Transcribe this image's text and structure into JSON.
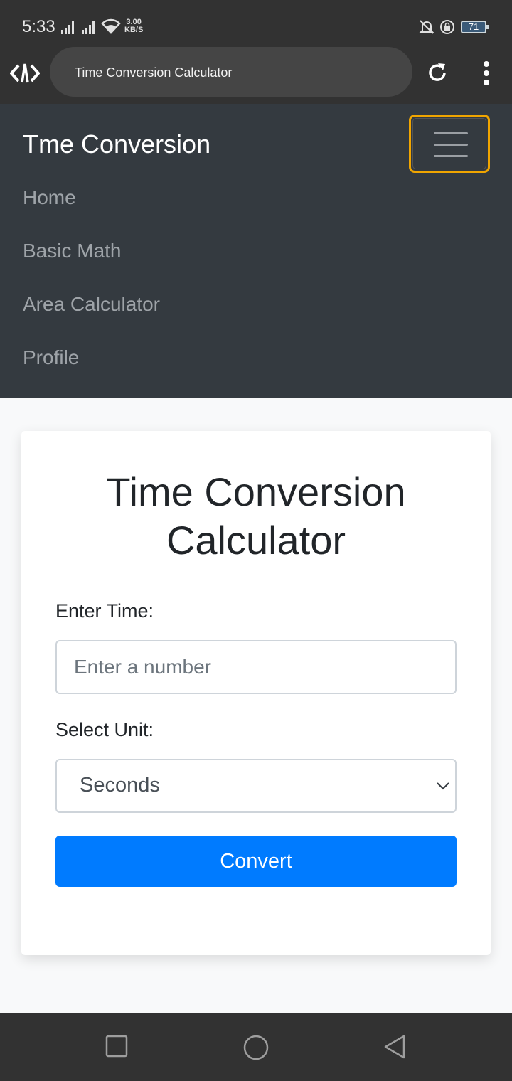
{
  "status_bar": {
    "time": "5:33",
    "speed_value": "3.00",
    "speed_unit": "KB/S",
    "battery": "71",
    "icons": [
      "signal-icon",
      "signal-icon",
      "wifi-icon",
      "mute-bell-icon",
      "lock-rotation-icon",
      "battery-icon"
    ]
  },
  "browser": {
    "url_title": "Time Conversion Calculator",
    "icons": [
      "app-logo-icon",
      "reload-icon",
      "more-vert-icon"
    ]
  },
  "navbar": {
    "brand": "Tme Conversion",
    "links": [
      "Home",
      "Basic Math",
      "Area Calculator",
      "Profile"
    ],
    "toggler_accent": "#f0a500"
  },
  "form": {
    "title": "Time Conversion Calculator",
    "time_label": "Enter Time:",
    "time_placeholder": "Enter a number",
    "time_value": "",
    "unit_label": "Select Unit:",
    "unit_selected": "Seconds",
    "convert_label": "Convert"
  },
  "colors": {
    "navbar_bg": "#343a40",
    "primary": "#007bff",
    "page_bg": "#f8f9fa"
  },
  "system_nav": {
    "icons": [
      "recents-square-icon",
      "home-circle-icon",
      "back-triangle-icon"
    ]
  }
}
